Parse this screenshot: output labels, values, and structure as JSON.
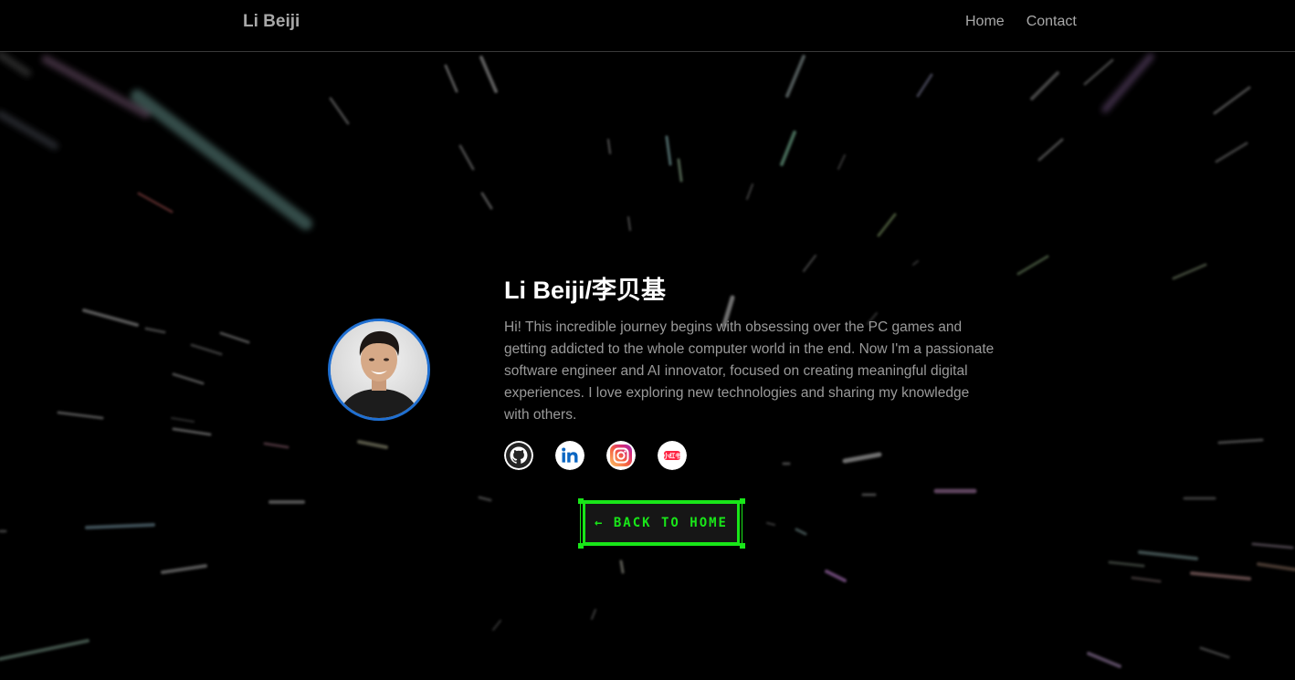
{
  "nav": {
    "brand": "Li Beiji",
    "links": [
      {
        "label": "Home"
      },
      {
        "label": "Contact"
      }
    ]
  },
  "profile": {
    "name": "Li Beiji/李贝基",
    "bio": "Hi! This incredible journey begins with obsessing over the PC games and getting addicted to the whole computer world in the end. Now I'm a passionate software engineer and AI innovator, focused on creating meaningful digital experiences. I love exploring new technologies and sharing my knowledge with others.",
    "socials": [
      {
        "icon": "github-icon"
      },
      {
        "icon": "linkedin-icon"
      },
      {
        "icon": "instagram-icon"
      },
      {
        "icon": "xiaohongshu-icon",
        "text": "小红书"
      }
    ]
  },
  "back_button": {
    "label": "← BACK TO HOME"
  },
  "colors": {
    "background": "#000000",
    "accent_green": "#19e619",
    "avatar_ring": "#1f6fd1",
    "nav_text": "#a8a8a8",
    "bio_text": "#9a9a9a"
  }
}
